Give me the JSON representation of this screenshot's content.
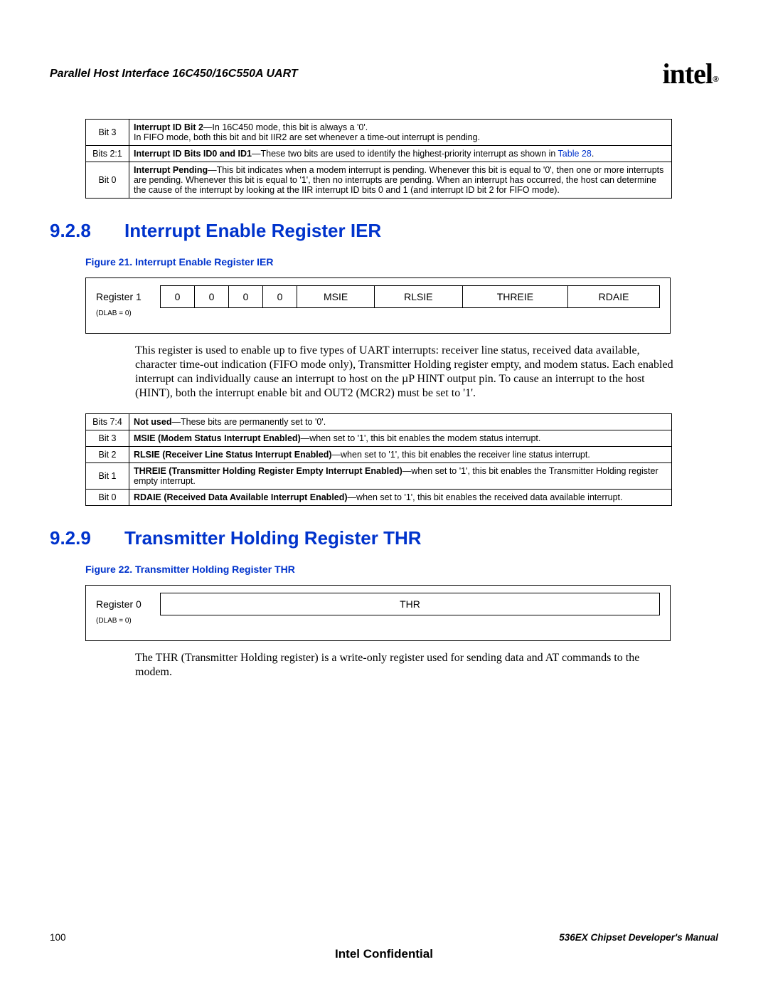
{
  "header": {
    "title": "Parallel Host Interface 16C450/16C550A UART",
    "logo_text": "intel",
    "logo_sub": "®"
  },
  "top_bit_table": [
    {
      "label": "Bit 3",
      "content_prefix_bold": "Interrupt ID Bit 2",
      "content_after": "—In 16C450 mode, this bit is always a '0'.",
      "content_line2": "In FIFO mode, both this bit and bit IIR2 are set whenever a time-out interrupt is pending."
    },
    {
      "label": "Bits 2:1",
      "content_prefix_bold": "Interrupt ID Bits ID0 and ID1",
      "content_after": "—These two bits are used to identify the highest-priority interrupt as shown in ",
      "link_text": "Table 28",
      "content_after2": "."
    },
    {
      "label": "Bit 0",
      "content_prefix_bold": "Interrupt Pending",
      "content_after": "—This bit indicates when a modem interrupt is pending. Whenever this bit is equal to '0', then one or more interrupts are pending. Whenever this bit is equal to '1', then no interrupts are pending. When an interrupt has occurred, the host can determine the cause of the interrupt by looking at the IIR interrupt ID bits 0 and 1 (and interrupt ID bit 2 for FIFO mode)."
    }
  ],
  "section1": {
    "num": "9.2.8",
    "title": "Interrupt Enable Register IER",
    "figure_caption": "Figure 21. Interrupt Enable Register IER",
    "reg_label": "Register 1",
    "dlab": "(DLAB = 0)",
    "cells": [
      "0",
      "0",
      "0",
      "0",
      "MSIE",
      "RLSIE",
      "THREIE",
      "RDAIE"
    ],
    "body": "This register is used to enable up to five types of UART interrupts: receiver line status, received data available, character time-out indication (FIFO mode only), Transmitter Holding register empty, and modem status. Each enabled interrupt can individually cause an interrupt to host on the µP HINT output pin. To cause an interrupt to the host (HINT), both the interrupt enable bit and OUT2 (MCR2) must be set to '1'."
  },
  "ier_bit_table": [
    {
      "label": "Bits 7:4",
      "bold": "Not used",
      "rest": "—These bits are permanently set to '0'."
    },
    {
      "label": "Bit 3",
      "bold": "MSIE (Modem Status Interrupt Enabled)",
      "rest": "—when set to '1', this bit enables the modem status interrupt."
    },
    {
      "label": "Bit 2",
      "bold": "RLSIE (Receiver Line Status Interrupt Enabled)",
      "rest": "—when set to '1', this bit enables the receiver line status interrupt."
    },
    {
      "label": "Bit 1",
      "bold": "THREIE (Transmitter Holding Register Empty Interrupt Enabled)",
      "rest": "—when set to '1', this bit enables the Transmitter Holding register empty interrupt."
    },
    {
      "label": "Bit 0",
      "bold": "RDAIE (Received Data Available Interrupt Enabled)",
      "rest": "—when set to '1', this bit enables the received data available interrupt."
    }
  ],
  "section2": {
    "num": "9.2.9",
    "title": "Transmitter Holding Register THR",
    "figure_caption": "Figure 22. Transmitter Holding Register THR",
    "reg_label": "Register 0",
    "dlab": "(DLAB = 0)",
    "cell": "THR",
    "body": "The THR (Transmitter Holding register) is a write-only register used for sending data and AT commands to the modem."
  },
  "footer": {
    "page_num": "100",
    "manual": "536EX Chipset Developer's Manual",
    "confidential": "Intel Confidential"
  }
}
